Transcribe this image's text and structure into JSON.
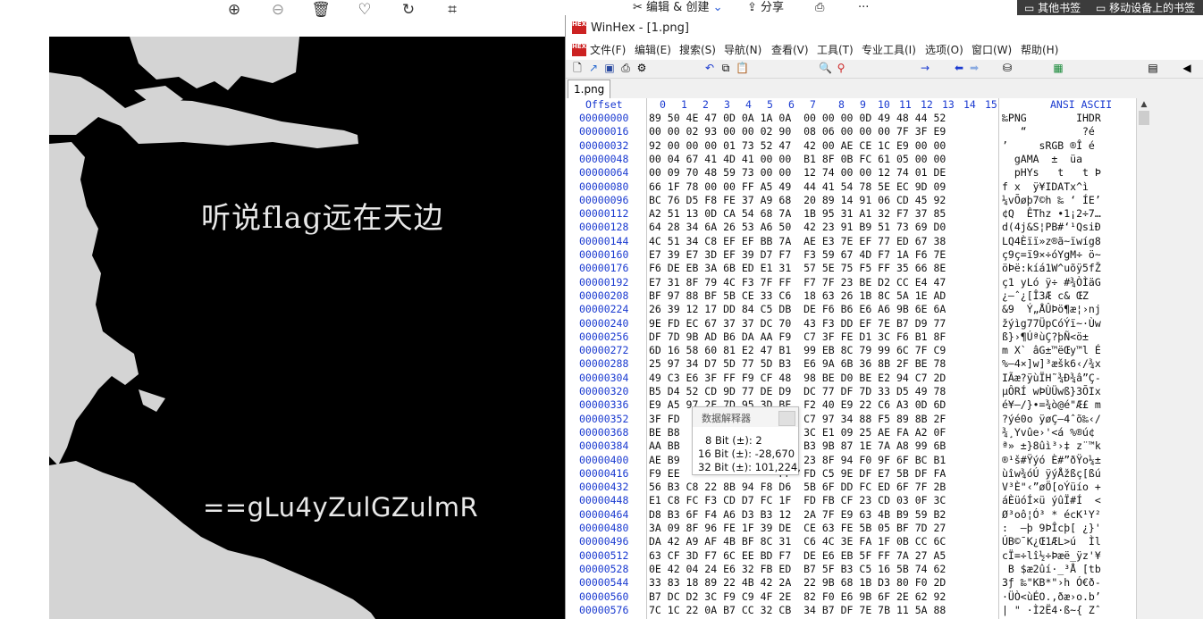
{
  "viewer": {
    "toolbar_icons": [
      "zoom-in-icon",
      "zoom-out-icon",
      "trash-icon",
      "heart-icon",
      "rotate-icon",
      "crop-icon"
    ],
    "image_text_line1": "听说flag远在天边",
    "image_text_line2": "==gLu4yZulGZulmR"
  },
  "app_strip": {
    "edit_create": "编辑 & 创建",
    "share": "分享",
    "more": "···"
  },
  "bookmarks": {
    "other": "其他书签",
    "mobile": "移动设备上的书签"
  },
  "winhex": {
    "title": "WinHex - [1.png]",
    "menu": [
      "文件(F)",
      "编辑(E)",
      "搜索(S)",
      "导航(N)",
      "查看(V)",
      "工具(T)",
      "专业工具(I)",
      "选项(O)",
      "窗口(W)",
      "帮助(H)"
    ],
    "tab": "1.png",
    "offset_header": "Offset",
    "column_headers": [
      "0",
      "1",
      "2",
      "3",
      "4",
      "5",
      "6",
      "7",
      "8",
      "9",
      "10",
      "11",
      "12",
      "13",
      "14",
      "15"
    ],
    "ansi_header": "ANSI ASCII",
    "rows": [
      {
        "offset": "00000000",
        "hex": "89 50 4E 47 0D 0A 1A 0A  00 00 00 0D 49 48 44 52",
        "text": "‰PNG        IHDR"
      },
      {
        "offset": "00000016",
        "hex": "00 00 02 93 00 00 02 90  08 06 00 00 00 7F 3F E9",
        "text": "   “         ?é"
      },
      {
        "offset": "00000032",
        "hex": "92 00 00 00 01 73 52 47  42 00 AE CE 1C E9 00 00",
        "text": "’     sRGB ®Î é  "
      },
      {
        "offset": "00000048",
        "hex": "00 04 67 41 4D 41 00 00  B1 8F 0B FC 61 05 00 00",
        "text": "  gAMA  ±  üa   "
      },
      {
        "offset": "00000064",
        "hex": "00 09 70 48 59 73 00 00  12 74 00 00 12 74 01 DE",
        "text": "  pHYs   t   t Þ"
      },
      {
        "offset": "00000080",
        "hex": "66 1F 78 00 00 FF A5 49  44 41 54 78 5E EC 9D 09",
        "text": "f x  ÿ¥IDATx^ì "
      },
      {
        "offset": "00000096",
        "hex": "BC 76 D5 F8 FE 37 A9 68  20 89 14 91 06 CD 45 92",
        "text": "¼vÕøþ7©h ‰ ‘ ÍE’"
      },
      {
        "offset": "00000112",
        "hex": "A2 51 13 0D CA 54 68 7A  1B 95 31 A1 32 F7 37 85",
        "text": "¢Q  ÊThz •1¡2÷7…"
      },
      {
        "offset": "00000128",
        "hex": "64 28 34 6A 26 53 A6 50  42 23 91 B9 51 73 69 D0",
        "text": "d(4j&S¦PB#‘¹QsiÐ"
      },
      {
        "offset": "00000144",
        "hex": "4C 51 34 C8 EF EF BB 7A  AE E3 7E EF 77 ED 67 38",
        "text": "LQ4Èïï»z®ã~ïwíg8"
      },
      {
        "offset": "00000160",
        "hex": "E7 39 E7 3D EF 39 D7 F7  F3 59 67 4D F7 1A F6 7E",
        "text": "ç9ç=ï9×÷óYgM÷ ö~"
      },
      {
        "offset": "00000176",
        "hex": "F6 DE EB 3A 6B ED E1 31  57 5E 75 F5 FF 35 66 8E",
        "text": "öÞë:kíá1W^uõÿ5fŽ"
      },
      {
        "offset": "00000192",
        "hex": "E7 31 8F 79 4C F3 7F FF  F7 7F 23 BE D2 CC E4 47",
        "text": "ç1 yLó ÿ÷ #¾ÒÌäG"
      },
      {
        "offset": "00000208",
        "hex": "BF 97 88 BF 5B CE 33 C6  18 63 26 1B 8C 5A 1E AD",
        "text": "¿—ˆ¿[Î3Æ c& ŒZ ­"
      },
      {
        "offset": "00000224",
        "hex": "26 39 12 17 DD 84 C5 DB  DE F6 B6 E6 A6 9B 6E 6A",
        "text": "&9  Ý„ÅÛÞö¶æ¦›nj"
      },
      {
        "offset": "00000240",
        "hex": "9E FD EC 67 37 37 DC 70  43 F3 DD EF 7E B7 D9 77",
        "text": "žýìg77ÜpCóÝï~·Ùw"
      },
      {
        "offset": "00000256",
        "hex": "DF 7D 9B AD B6 DA AA F9  C7 3F FE D1 3C F6 B1 8F",
        "text": "ß}›­¶ÚªùÇ?þÑ<ö± "
      },
      {
        "offset": "00000272",
        "hex": "6D 16 58 60 81 E2 47 B1  99 EB 8C 79 99 6C 7F C9",
        "text": "m X` âG±™ëŒy™l É"
      },
      {
        "offset": "00000288",
        "hex": "25 97 34 D7 5D 77 5D B3  E6 9A 6B 36 8B 2F BE 78",
        "text": "%—4×]w]³æšk6‹/¾x"
      },
      {
        "offset": "00000304",
        "hex": "49 C3 E6 3F FF F9 CF 48  98 BE D0 BE E2 94 C7 2D",
        "text": "IÃæ?ÿùÏH˜¾Ð¾â”Ç-"
      },
      {
        "offset": "00000320",
        "hex": "B5 D4 52 CD 9D 77 DE D9  DC 77 DF 7D 33 D5 49 78",
        "text": "µÔRÍ wÞÙÜwß}3ÕIx"
      },
      {
        "offset": "00000336",
        "hex": "E9 A5 97 2F 7D 95 3D BE  F2 40 E9 22 C6 A3 0D 6D",
        "text": "é¥—/}•=¾ò@é\"Æ£ m"
      },
      {
        "offset": "00000352",
        "hex": "3F FD                F8  C7 97 34 88 F5 89 8B 2F",
        "text": "?ýé0o ÿøÇ—4ˆõ‰‹/"
      },
      {
        "offset": "00000368",
        "hex": "BE B8                27  3C E1 09 25 AE FA A2 0F",
        "text": "¾¸Yvûe›'<á %®ú¢ "
      },
      {
        "offset": "00000384",
        "hex": "AA BB                EC  B3 9B 87 1E 7A A8 99 6B",
        "text": "ª» ±}8ûì³›‡ z¨™k"
      },
      {
        "offset": "00000400",
        "hex": "AE B9                C8  23 8F 94 F0 9F 6F BC B1",
        "text": "®¹š#Ÿýó È#”ðŸo¼±"
      },
      {
        "offset": "00000416",
        "hex": "F9 EE                FF  FD C5 9E DF E7 5B DF FA",
        "text": "ùîw¾óÚ ÿýÅžßç[ßú"
      },
      {
        "offset": "00000432",
        "hex": "56 B3 C8 22 8B 94 F8 D6  5B 6F DD FC ED 6F 7F 2B",
        "text": "V³È\"‹”øÖ[oÝüío +"
      },
      {
        "offset": "00000448",
        "hex": "E1 C8 FC F3 CD D7 FC 1F  FD FB CF 23 CD 03 0F 3C",
        "text": "áÈüóÍ×ü ýûÏ#Í  <"
      },
      {
        "offset": "00000464",
        "hex": "D8 B3 6F F4 A6 D3 B3 12  2A 7F E9 63 4B B9 59 B2",
        "text": "Ø³oô¦Ó³ * écK¹Y²"
      },
      {
        "offset": "00000480",
        "hex": "3A 09 8F 96 FE 1F 39 DE  CE 63 FE 5B 05 BF 7D 27",
        "text": ":  –þ 9ÞÎcþ[ ¿}'"
      },
      {
        "offset": "00000496",
        "hex": "DA 42 A9 AF 4B BF 8C 31  C6 4C 3E FA 1F 0B CC 6C",
        "text": "ÚB©¯K¿Œ1ÆL>ú  Ìl"
      },
      {
        "offset": "00000512",
        "hex": "63 CF 3D F7 6C EE BD F7  DE E6 EB 5F FF 7A 27 A5",
        "text": "cÏ=÷lî½÷Þæë_ÿz'¥"
      },
      {
        "offset": "00000528",
        "hex": "0E 42 04 24 E6 32 FB ED  B7 5F B3 C5 16 5B 74 62",
        "text": " B $æ2ûí·_³Å [tb"
      },
      {
        "offset": "00000544",
        "hex": "33 83 18 89 22 4B 42 2A  22 9B 68 1B D3 80 F0 2D",
        "text": "3ƒ ‰\"KB*\"›h Ó€ð-"
      },
      {
        "offset": "00000560",
        "hex": "B7 DC D2 3C F9 C9 4F 2E  82 F0 E6 9B 6F 2E 62 92",
        "text": "·ÜÒ<ùÉO.‚ðæ›o.b’"
      },
      {
        "offset": "00000576",
        "hex": "7C 1C 22 0A B7 CC 32 CB  34 B7 DF 7E 7B 11 5A 88",
        "text": "| \" ·Ì2Ë4·ß~{ Zˆ"
      }
    ],
    "interpreter": {
      "title": "数据解释器",
      "bit8": "8 Bit (±): 2",
      "bit16": "16 Bit (±): -28,670",
      "bit32": "32 Bit (±): 101,224,"
    }
  },
  "colors": {
    "offset_blue": "#1a3ad0",
    "logo_red": "#cc2222",
    "image_bg": "#000000",
    "map_gray": "#d4d4d4"
  }
}
